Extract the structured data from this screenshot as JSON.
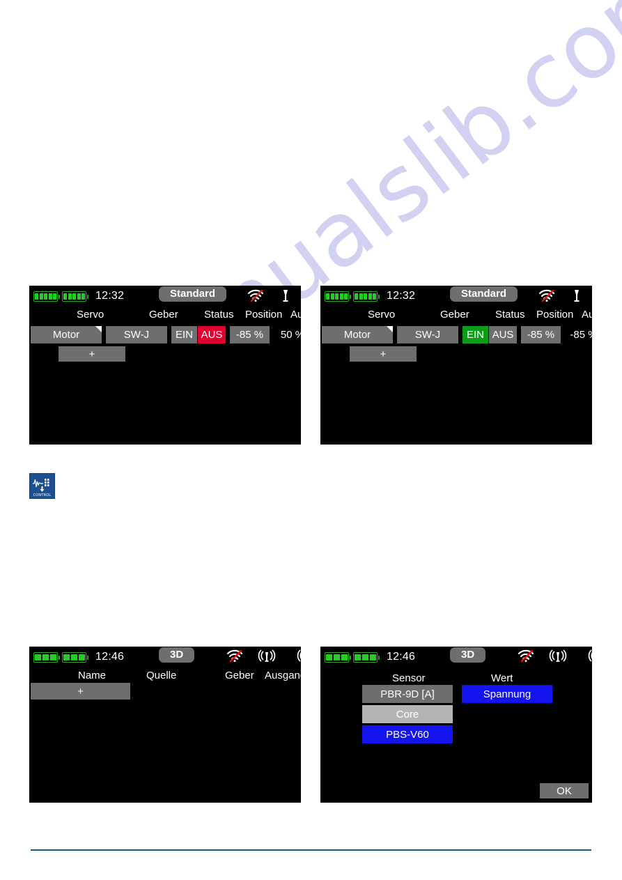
{
  "page": {
    "watermark": "manualslib.com",
    "rule_color": "#0b5e7a"
  },
  "app_icon": {
    "name": "control-app-icon",
    "label": "CONTROL"
  },
  "screens": [
    {
      "id": "screen-servo-aus",
      "statusbar": {
        "battery_1_bars": 5,
        "battery_2_bars": 5,
        "time": "12:32",
        "mode_pill": "Standard",
        "icons": [
          "wifi-off-icon",
          "antenna-icon",
          "antenna-icon"
        ]
      },
      "columns": [
        "Servo",
        "Geber",
        "Status",
        "Position",
        "Ausgang"
      ],
      "rows": [
        {
          "servo": "Motor",
          "geber": "SW-J",
          "status_on": "EIN",
          "status_off": "AUS",
          "status_active": "AUS",
          "position": "-85 %",
          "ausgang": "50 %"
        }
      ],
      "add_button": "+"
    },
    {
      "id": "screen-servo-ein",
      "statusbar": {
        "battery_1_bars": 5,
        "battery_2_bars": 5,
        "time": "12:32",
        "mode_pill": "Standard",
        "icons": [
          "wifi-off-icon",
          "antenna-icon",
          "antenna-icon"
        ]
      },
      "columns": [
        "Servo",
        "Geber",
        "Status",
        "Position",
        "Ausgang"
      ],
      "rows": [
        {
          "servo": "Motor",
          "geber": "SW-J",
          "status_on": "EIN",
          "status_off": "AUS",
          "status_active": "EIN",
          "position": "-85 %",
          "ausgang": "-85 %"
        }
      ],
      "add_button": "+"
    },
    {
      "id": "screen-telemetry-empty",
      "statusbar": {
        "battery_1_bars": 3,
        "battery_2_bars": 3,
        "time": "12:46",
        "mode_pill": "3D",
        "icons": [
          "wifi-off-icon",
          "antenna-signal-icon",
          "antenna-signal-icon"
        ]
      },
      "columns": [
        "Name",
        "Quelle",
        "Geber",
        "Ausgang"
      ],
      "rows": [],
      "add_button": "+"
    },
    {
      "id": "screen-sensor-select",
      "statusbar": {
        "battery_1_bars": 3,
        "battery_2_bars": 3,
        "time": "12:46",
        "mode_pill": "3D",
        "icons": [
          "wifi-off-icon",
          "antenna-signal-icon",
          "antenna-signal-icon"
        ]
      },
      "columns": [
        "Sensor",
        "Wert"
      ],
      "sensor_list": [
        {
          "label": "PBR-9D [A]",
          "state": "normal"
        },
        {
          "label": "Core",
          "state": "highlight"
        },
        {
          "label": "PBS-V60",
          "state": "selected"
        }
      ],
      "value_list": [
        {
          "label": "Spannung",
          "state": "selected"
        }
      ],
      "ok_button": "OK"
    }
  ],
  "colors": {
    "gray": "#6e6e6e",
    "light_gray": "#b4b4b4",
    "red": "#e00030",
    "green": "#0b9d18",
    "blue": "#1414ee",
    "battery_green": "#1fd01f"
  }
}
